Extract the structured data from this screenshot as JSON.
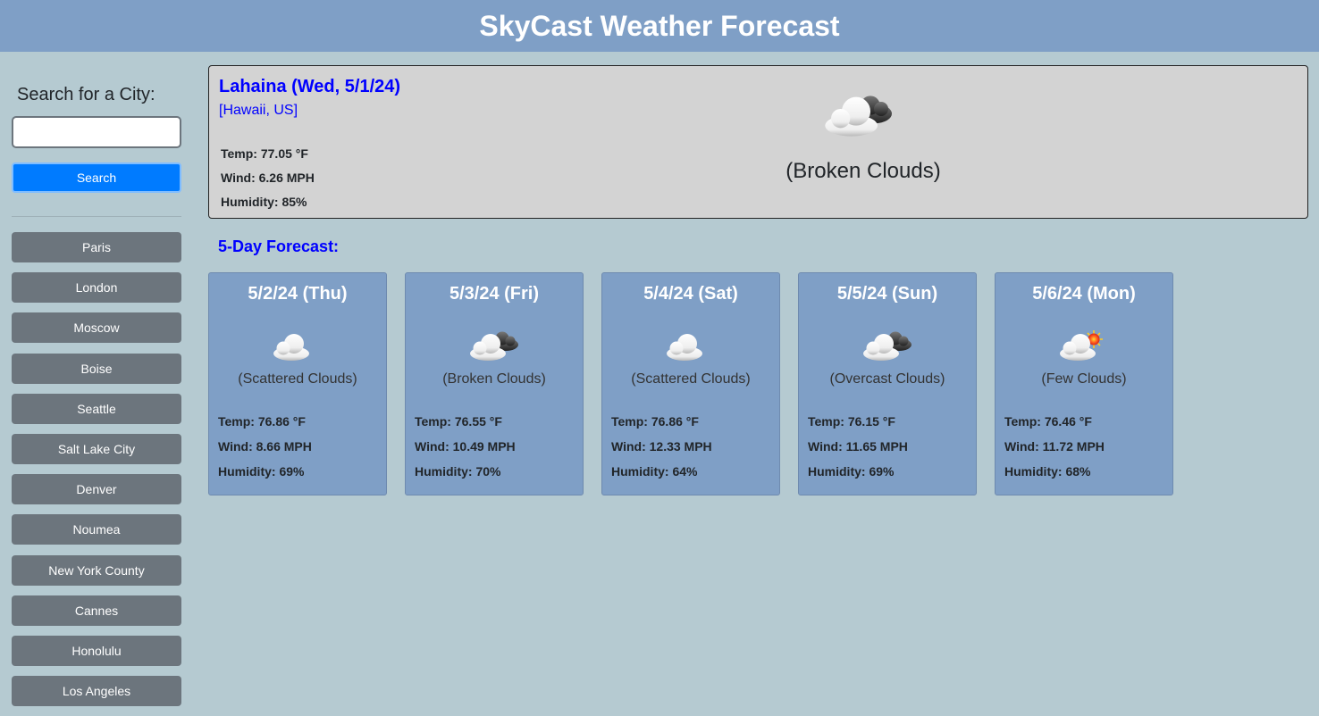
{
  "header": {
    "title": "SkyCast Weather Forecast"
  },
  "sidebar": {
    "search_label": "Search for a City:",
    "search_value": "",
    "search_button": "Search",
    "cities": [
      "Paris",
      "London",
      "Moscow",
      "Boise",
      "Seattle",
      "Salt Lake City",
      "Denver",
      "Noumea",
      "New York County",
      "Cannes",
      "Honolulu",
      "Los Angeles"
    ]
  },
  "current": {
    "title": "Lahaina (Wed, 5/1/24)",
    "location": "[Hawaii, US]",
    "temp": "Temp: 77.05 °F",
    "wind": "Wind: 6.26 MPH",
    "humidity": "Humidity: 85%",
    "icon": "broken-clouds-icon",
    "description": "(Broken Clouds)"
  },
  "forecast": {
    "title": "5-Day Forecast:",
    "days": [
      {
        "date": "5/2/24 (Thu)",
        "icon": "scattered-clouds-icon",
        "description": "(Scattered Clouds)",
        "temp": "Temp: 76.86 °F",
        "wind": "Wind: 8.66 MPH",
        "humidity": "Humidity: 69%"
      },
      {
        "date": "5/3/24 (Fri)",
        "icon": "broken-clouds-icon",
        "description": "(Broken Clouds)",
        "temp": "Temp: 76.55 °F",
        "wind": "Wind: 10.49 MPH",
        "humidity": "Humidity: 70%"
      },
      {
        "date": "5/4/24 (Sat)",
        "icon": "scattered-clouds-icon",
        "description": "(Scattered Clouds)",
        "temp": "Temp: 76.86 °F",
        "wind": "Wind: 12.33 MPH",
        "humidity": "Humidity: 64%"
      },
      {
        "date": "5/5/24 (Sun)",
        "icon": "overcast-clouds-icon",
        "description": "(Overcast Clouds)",
        "temp": "Temp: 76.15 °F",
        "wind": "Wind: 11.65 MPH",
        "humidity": "Humidity: 69%"
      },
      {
        "date": "5/6/24 (Mon)",
        "icon": "few-clouds-icon",
        "description": "(Few Clouds)",
        "temp": "Temp: 76.46 °F",
        "wind": "Wind: 11.72 MPH",
        "humidity": "Humidity: 68%"
      }
    ]
  },
  "colors": {
    "header_bg": "#7f9fc6",
    "page_bg": "#b5cad1",
    "accent_text": "#0000ff",
    "search_button": "#007bff",
    "city_button": "#6c757d"
  }
}
